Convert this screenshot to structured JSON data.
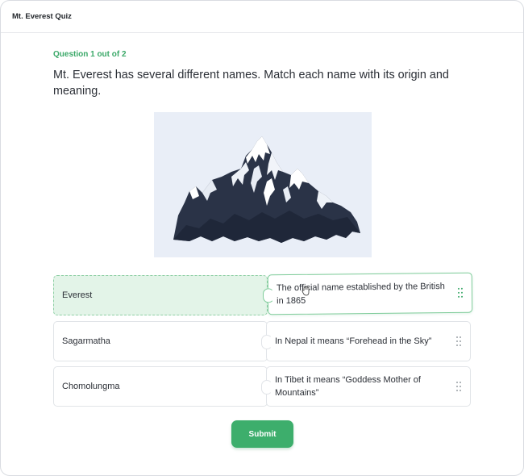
{
  "app": {
    "title": "Mt. Everest Quiz"
  },
  "quiz": {
    "progress": "Question 1 out of 2",
    "question": "Mt. Everest has several different names. Match each name with its origin and meaning.",
    "image": {
      "icon": "mountain-illustration",
      "background": "#e9eef7"
    },
    "pairs": [
      {
        "name": "Everest",
        "meaning": "The official name established by the British in 1865",
        "state": "matched"
      },
      {
        "name": "Sagarmatha",
        "meaning": "In Nepal it means “Forehead in the Sky”",
        "state": "idle"
      },
      {
        "name": "Chomolungma",
        "meaning": "In Tibet it means “Goddess Mother of Mountains”",
        "state": "idle"
      }
    ],
    "submit_label": "Submit"
  },
  "colors": {
    "accent": "#3dae6c",
    "matched_bg": "#e3f4e8",
    "mountain": "#2a3347"
  },
  "icons": {
    "grip": "drag-handle-icon",
    "cursor": "grab-cursor-icon"
  }
}
